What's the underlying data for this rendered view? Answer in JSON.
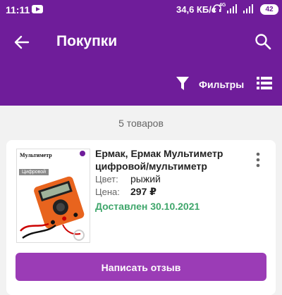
{
  "status_bar": {
    "time": "11:11",
    "network_speed": "34,6 КБ/с",
    "network_type": "4G",
    "battery": "42",
    "icons": [
      "youtube-icon",
      "headphones-icon",
      "signal-icon",
      "signal-icon",
      "battery-icon"
    ]
  },
  "app_bar": {
    "title": "Покупки",
    "filters_label": "Фильтры",
    "icons": [
      "back-arrow-icon",
      "search-icon",
      "filter-icon",
      "list-view-icon"
    ],
    "background_color": "#6f1d9a"
  },
  "list": {
    "count_label": "5 товаров"
  },
  "order": {
    "title": "Ермак, Ермак Мультиметр цифровой/мультиметр",
    "color_label": "Цвет:",
    "color_value": "рыжий",
    "price_label": "Цена:",
    "price_value": "297 ₽",
    "status": "Доставлен 30.10.2021",
    "status_color": "#3fa66b",
    "review_button": "Написать отзыв",
    "review_button_color": "#9b3cb6",
    "image": {
      "title": "Мультиметр",
      "tag": "Цифровой"
    }
  }
}
